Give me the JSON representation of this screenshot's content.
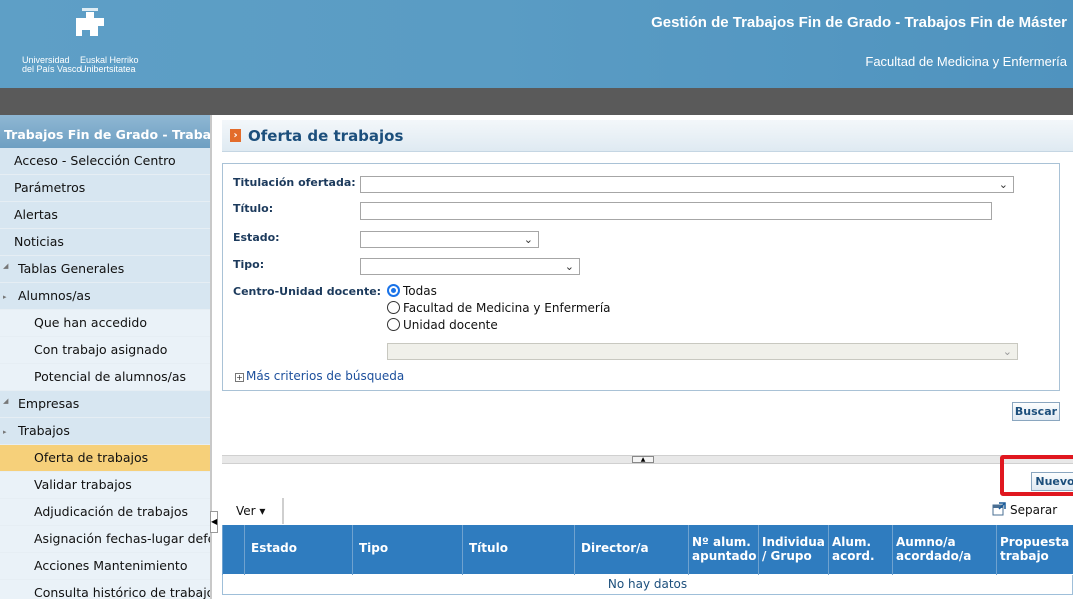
{
  "header": {
    "logo_line1": "Universidad del País Vasco",
    "logo_line1a": "Universidad",
    "logo_line1b": "del País Vasco",
    "logo_line2a": "Euskal Herriko",
    "logo_line2b": "Unibertsitatea",
    "app_title": "Gestión de Trabajos Fin de Grado - Trabajos Fin de Máster",
    "faculty": "Facultad de Medicina y Enfermería"
  },
  "sidebar": {
    "title": "Trabajos Fin de Grado - Trabajos Fin de Máster",
    "items": [
      {
        "label": "Acceso - Selección Centro"
      },
      {
        "label": "Parámetros"
      },
      {
        "label": "Alertas"
      },
      {
        "label": "Noticias"
      },
      {
        "label": "Tablas Generales"
      },
      {
        "label": "Alumnos/as"
      },
      {
        "label": "Que han accedido"
      },
      {
        "label": "Con trabajo asignado"
      },
      {
        "label": "Potencial de alumnos/as"
      },
      {
        "label": "Empresas"
      },
      {
        "label": "Trabajos"
      },
      {
        "label": "Oferta de trabajos"
      },
      {
        "label": "Validar trabajos"
      },
      {
        "label": "Adjudicación de trabajos"
      },
      {
        "label": "Asignación fechas-lugar defensa"
      },
      {
        "label": "Acciones Mantenimiento"
      },
      {
        "label": "Consulta histórico de trabajos"
      }
    ]
  },
  "page": {
    "title": "Oferta de trabajos"
  },
  "search": {
    "titulacion_label": "Titulación ofertada:",
    "titulacion_value": "",
    "titulo_label": "Título:",
    "titulo_value": "",
    "estado_label": "Estado:",
    "estado_value": "",
    "tipo_label": "Tipo:",
    "tipo_value": "",
    "centro_label": "Centro-Unidad docente:",
    "options": [
      "Todas",
      "Facultad de Medicina y Enfermería",
      "Unidad docente"
    ],
    "selected_option": "Todas",
    "unidad_value": "",
    "more_criteria": "Más criterios de búsqueda"
  },
  "buttons": {
    "buscar": "Buscar",
    "nuevo": "Nuevo"
  },
  "toolbar": {
    "ver": "Ver",
    "separar": "Separar"
  },
  "grid": {
    "columns": [
      "Estado",
      "Tipo",
      "Título",
      "Director/a",
      "Nº alum. apuntado",
      "Individua / Grupo",
      "Alum. acord.",
      "Aumno/a acordado/a",
      "Propuesta trabajo"
    ],
    "empty_text": "No hay datos"
  },
  "colors": {
    "header_blue": "#5a9cc4",
    "active_item": "#f6d07a",
    "grid_header": "#2f7cbf",
    "highlight_red": "#e0171f"
  }
}
